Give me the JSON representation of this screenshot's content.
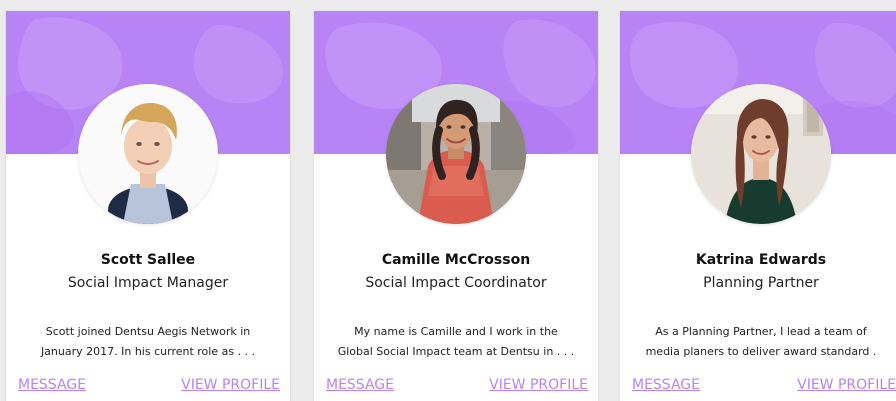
{
  "theme": {
    "accent": "#b883f5",
    "card_background": "#ffffff",
    "page_background": "#ececec"
  },
  "cards": [
    {
      "name": "Scott Sallee",
      "role": "Social Impact Manager",
      "bio_line_1": "Scott joined Dentsu Aegis Network in",
      "bio_line_2": "January 2017. In his current role as . . .",
      "message_label": "MESSAGE",
      "view_profile_label": "VIEW PROFILE"
    },
    {
      "name": "Camille McCrosson",
      "role": "Social Impact Coordinator",
      "bio_line_1": "My name is Camille and I work in the",
      "bio_line_2": "Global Social Impact team at Dentsu in . . .",
      "message_label": "MESSAGE",
      "view_profile_label": "VIEW PROFILE"
    },
    {
      "name": "Katrina Edwards",
      "role": "Planning Partner",
      "bio_line_1": "As a Planning Partner, I lead a team of",
      "bio_line_2": "media planers to deliver award standard .",
      "message_label": "MESSAGE",
      "view_profile_label": "VIEW PROFILE"
    }
  ]
}
